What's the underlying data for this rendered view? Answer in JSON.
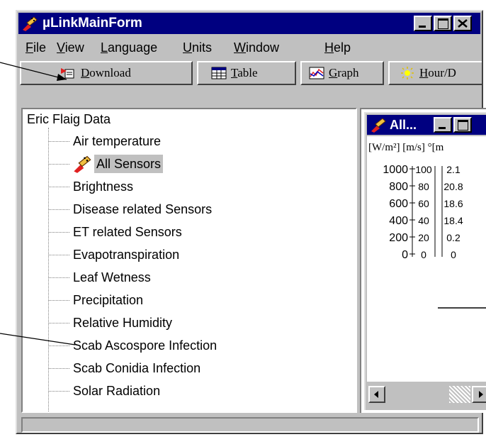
{
  "window": {
    "title": "µLinkMainForm"
  },
  "menu": [
    {
      "label": "File",
      "accel": "F",
      "rest": "ile"
    },
    {
      "label": "View",
      "accel": "V",
      "rest": "iew"
    },
    {
      "label": "Language",
      "accel": "L",
      "rest": "anguage"
    },
    {
      "label": "Units",
      "accel": "U",
      "rest": "nits"
    },
    {
      "label": "Window",
      "accel": "W",
      "rest": "indow"
    },
    {
      "label": "Help",
      "accel": "H",
      "rest": "elp"
    }
  ],
  "toolbar": {
    "download": {
      "accel": "D",
      "rest": "ownload"
    },
    "table": {
      "accel": "T",
      "rest": "able"
    },
    "graph": {
      "accel": "G",
      "rest": "raph"
    },
    "hour": {
      "accel": "H",
      "rest": "our/D"
    }
  },
  "tree": {
    "root": "Eric Flaig Data",
    "items": [
      "Air temperature",
      "All Sensors",
      "Brightness",
      "Disease related Sensors",
      "ET related Sensors",
      "Evapotranspiration",
      "Leaf Wetness",
      "Precipitation",
      "Relative Humidity",
      "Scab Ascospore Infection",
      "Scab Conidia Infection",
      "Solar Radiation"
    ],
    "selected": "All Sensors"
  },
  "child_window": {
    "title": "All...",
    "units": "[W/m²]   [m/s]  °[m",
    "axis_ticks": [
      "1000",
      "800",
      "600",
      "400",
      "200",
      "0"
    ],
    "col2_ticks": [
      "100",
      "80",
      "60",
      "40",
      "20",
      "0"
    ],
    "col3_ticks": [
      "2.1",
      "20.8",
      "18.6",
      "18.4",
      "0.2",
      "0"
    ]
  },
  "colors": {
    "titlebar": "#000080",
    "face": "#c0c0c0",
    "selection": "#c0c0c0"
  }
}
